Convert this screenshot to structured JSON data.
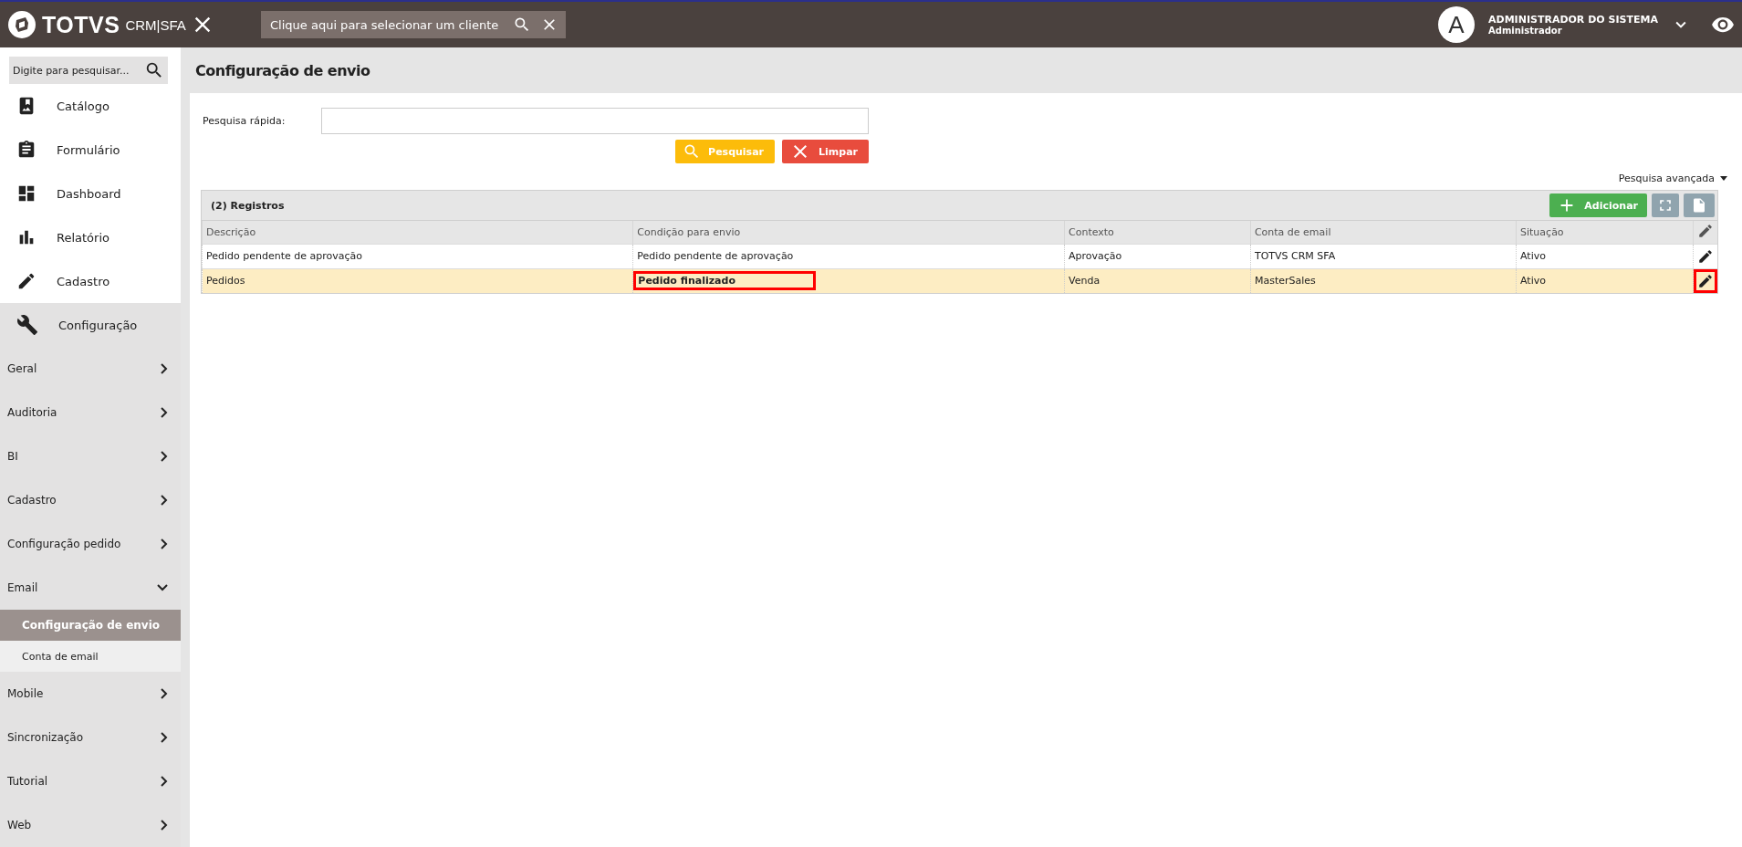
{
  "header": {
    "logo_text": "TOTVS",
    "product": "CRM|SFA",
    "client_search": {
      "placeholder": "Clique aqui para selecionar um cliente"
    },
    "user": {
      "avatar_letter": "A",
      "name": "ADMINISTRADOR DO SISTEMA",
      "role": "Administrador"
    }
  },
  "sidebar": {
    "search": {
      "placeholder": "Digite para pesquisar..."
    },
    "menu": [
      {
        "label": "Catálogo"
      },
      {
        "label": "Formulário"
      },
      {
        "label": "Dashboard"
      },
      {
        "label": "Relatório"
      },
      {
        "label": "Cadastro"
      },
      {
        "label": "Configuração",
        "expanded": true,
        "children": [
          {
            "label": "Geral",
            "expanded": false
          },
          {
            "label": "Auditoria",
            "expanded": false
          },
          {
            "label": "BI",
            "expanded": false
          },
          {
            "label": "Cadastro",
            "expanded": false
          },
          {
            "label": "Configuração pedido",
            "expanded": false
          },
          {
            "label": "Email",
            "expanded": true,
            "children": [
              {
                "label": "Configuração de envio",
                "selected": true
              },
              {
                "label": "Conta de email",
                "selected": false
              }
            ]
          },
          {
            "label": "Mobile",
            "expanded": false
          },
          {
            "label": "Sincronização",
            "expanded": false
          },
          {
            "label": "Tutorial",
            "expanded": false
          },
          {
            "label": "Web",
            "expanded": false
          }
        ]
      }
    ]
  },
  "page": {
    "title": "Configuração de envio",
    "quick_search": {
      "label": "Pesquisa rápida:"
    },
    "buttons": [
      {
        "label": "Pesquisar",
        "kind": "search"
      },
      {
        "label": "Limpar",
        "kind": "clear"
      }
    ],
    "advanced_search": "Pesquisa avançada"
  },
  "table": {
    "count": "(2) Registros",
    "add_button": "Adicionar",
    "columns": [
      "Descrição",
      "Condição para envio",
      "Contexto",
      "Conta de email",
      "Situação"
    ],
    "rows": [
      {
        "selected": false,
        "edit_highlighted": false,
        "cells": [
          {
            "text": "Pedido pendente de aprovação",
            "highlighted": false
          },
          {
            "text": "Pedido pendente de aprovação",
            "highlighted": false
          },
          {
            "text": "Aprovação",
            "highlighted": false
          },
          {
            "text": "TOTVS CRM SFA",
            "highlighted": false
          },
          {
            "text": "Ativo",
            "highlighted": false
          }
        ]
      },
      {
        "selected": true,
        "edit_highlighted": true,
        "cells": [
          {
            "text": "Pedidos",
            "highlighted": false
          },
          {
            "text": "Pedido finalizado",
            "highlighted": true
          },
          {
            "text": "Venda",
            "highlighted": false
          },
          {
            "text": "MasterSales",
            "highlighted": false
          },
          {
            "text": "Ativo",
            "highlighted": false
          }
        ]
      }
    ]
  }
}
